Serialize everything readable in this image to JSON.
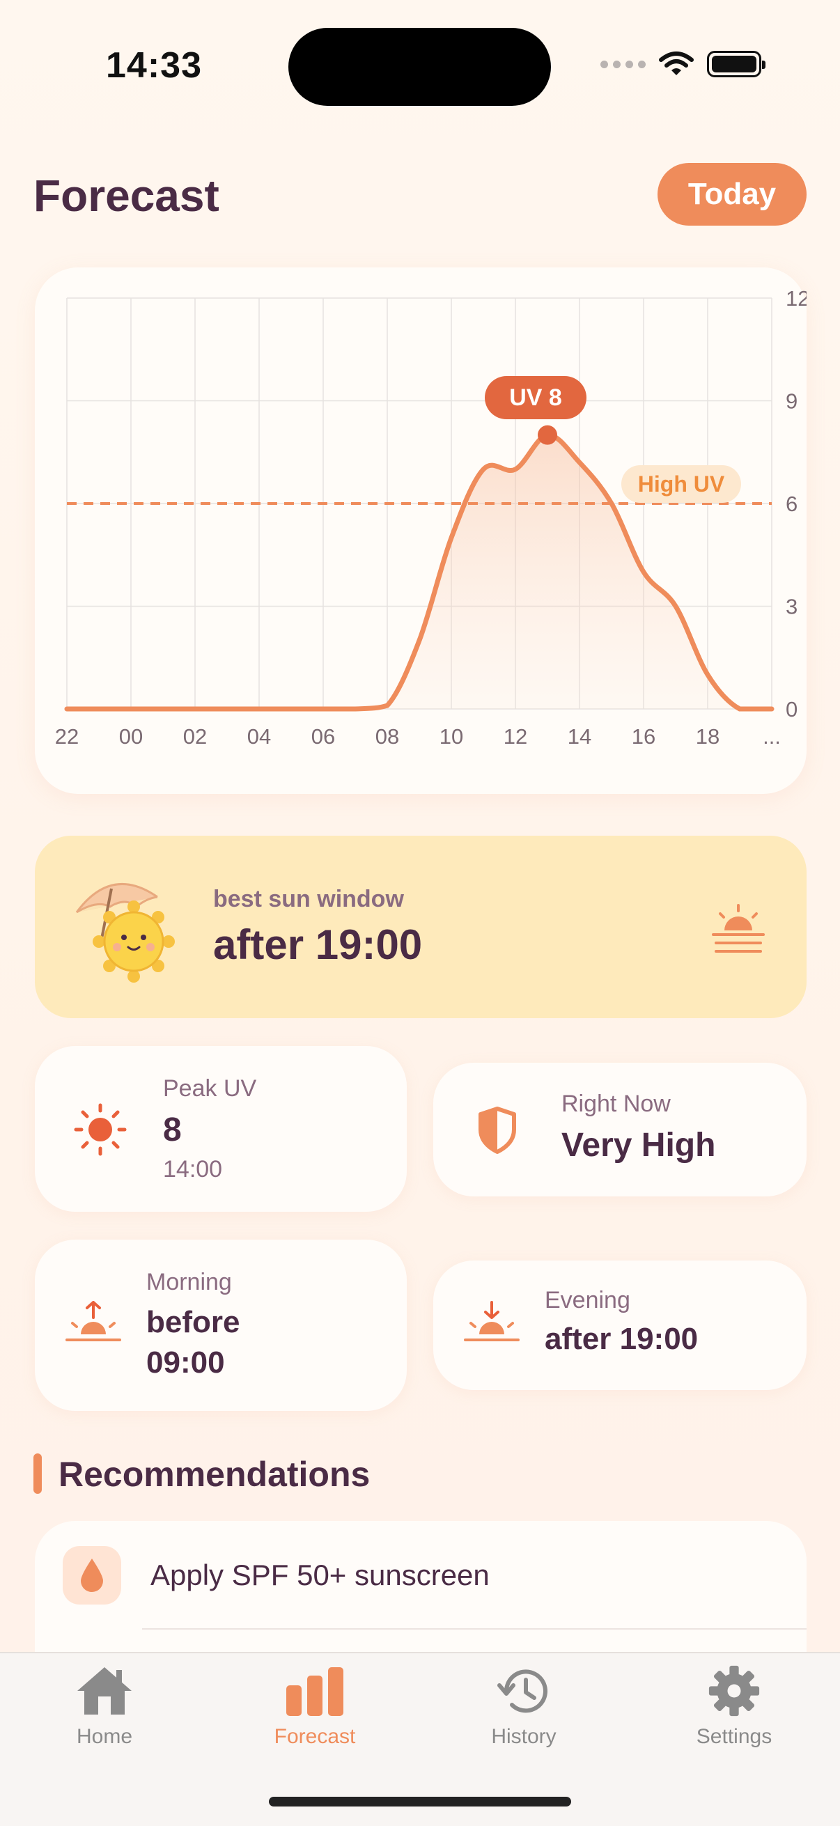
{
  "status": {
    "time": "14:33"
  },
  "header": {
    "title": "Forecast",
    "today_button": "Today"
  },
  "chart": {
    "peak_badge": "UV 8",
    "threshold_label": "High UV",
    "accent": "#ef8c5b"
  },
  "chart_data": {
    "type": "area",
    "x": [
      "22",
      "00",
      "02",
      "04",
      "06",
      "08",
      "10",
      "12",
      "14",
      "16",
      "18",
      "..."
    ],
    "x_hours": [
      22,
      23,
      24,
      25,
      26,
      27,
      28,
      29,
      30,
      31,
      32,
      33,
      34,
      35,
      36,
      37,
      38,
      39,
      40,
      41,
      42,
      43,
      44
    ],
    "series": [
      {
        "values": [
          0,
          0,
          0,
          0,
          0,
          0,
          0,
          0,
          0,
          0,
          0.1,
          2,
          5,
          7,
          7,
          8,
          7.2,
          6,
          4,
          3,
          1,
          0,
          0
        ]
      }
    ],
    "yticks": [
      "0",
      "3",
      "6",
      "9",
      "12"
    ],
    "ylim": [
      0,
      12
    ],
    "threshold": 6,
    "peak": {
      "x": "14:00",
      "y": 8
    },
    "grid": true
  },
  "best_window": {
    "label": "best sun window",
    "value": "after 19:00"
  },
  "stats": {
    "peak": {
      "label": "Peak UV",
      "value": "8",
      "sub": "14:00"
    },
    "now": {
      "label": "Right Now",
      "value": "Very High"
    },
    "morning": {
      "label": "Morning",
      "value_line1": "before",
      "value_line2": "09:00"
    },
    "evening": {
      "label": "Evening",
      "value": "after 19:00"
    }
  },
  "recommendations": {
    "title": "Recommendations",
    "items": [
      {
        "text": "Apply SPF 50+ sunscreen",
        "icon": "drop-icon"
      }
    ]
  },
  "tabs": [
    {
      "label": "Home",
      "icon": "home-icon"
    },
    {
      "label": "Forecast",
      "icon": "bar-chart-icon",
      "active": true
    },
    {
      "label": "History",
      "icon": "history-icon"
    },
    {
      "label": "Settings",
      "icon": "gear-icon"
    }
  ]
}
